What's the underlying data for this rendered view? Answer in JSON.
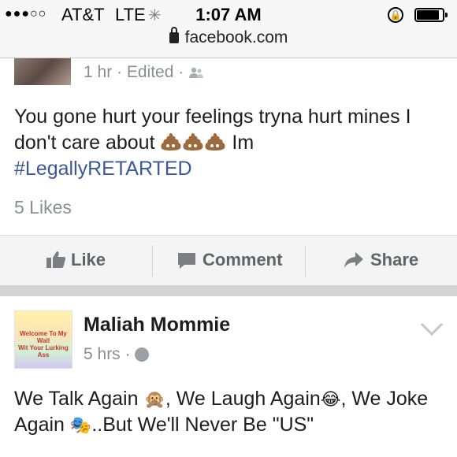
{
  "status_bar": {
    "signal": "●●●○○",
    "carrier": "AT&T",
    "network": "LTE",
    "time": "1:07 AM",
    "url": "facebook.com"
  },
  "post1": {
    "time": "1 hr · Edited ·",
    "text_line1": "You gone hurt your feelings tryna hurt mines I",
    "text_line2_start": "don't care about",
    "text_line2_end": "Im",
    "hashtag": "#LegallyRETARTED",
    "likes": "5 Likes"
  },
  "actions": {
    "like": "Like",
    "comment": "Comment",
    "share": "Share"
  },
  "post2": {
    "avatar_text_1": "Welcome To My Wall",
    "avatar_text_2": "Wit Your Lurking Ass",
    "author": "Maliah Mommie",
    "time": "5 hrs ·",
    "text_a": "We Talk Again",
    "text_b": ", We Laugh Again",
    "text_c": ", We Joke",
    "text_d": "Again",
    "text_e": "..But We'll Never Be \"US\""
  },
  "icons": {
    "friends": "friends-icon",
    "globe": "globe-icon",
    "like": "thumbs-up-icon",
    "comment": "comment-bubble-icon",
    "share": "share-arrow-icon",
    "poop": "poop-emoji-icon"
  },
  "colors": {
    "hashtag": "#3b5998",
    "meta": "#8a8d91",
    "action": "#5f6368"
  }
}
